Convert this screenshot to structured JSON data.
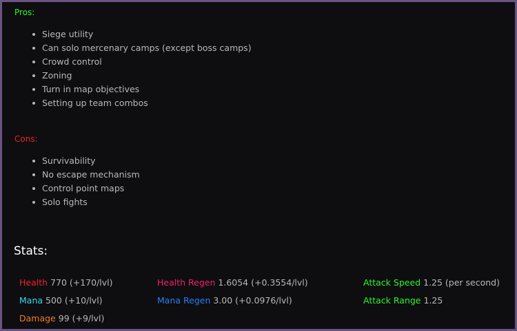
{
  "pros": {
    "heading": "Pros:",
    "items": [
      "Siege utility",
      "Can solo mercenary camps (except boss camps)",
      "Crowd control",
      "Zoning",
      "Turn in map objectives",
      "Setting up team combos"
    ]
  },
  "cons": {
    "heading": "Cons:",
    "items": [
      "Survivability",
      "No escape mechanism",
      "Control point maps",
      "Solo fights"
    ]
  },
  "stats": {
    "title": "Stats:",
    "health": {
      "label": "Health",
      "value": "770 (+170/lvl)",
      "color": "#f0202a"
    },
    "mana": {
      "label": "Mana",
      "value": "500 (+10/lvl)",
      "color": "#3fd9f0"
    },
    "damage": {
      "label": "Damage",
      "value": "99 (+9/lvl)",
      "color": "#f07a2a"
    },
    "health_regen": {
      "label": "Health Regen",
      "value": "1.6054 (+0.3554/lvl)",
      "color": "#f0206a"
    },
    "mana_regen": {
      "label": "Mana Regen",
      "value": "3.00 (+0.0976/lvl)",
      "color": "#2a7df0"
    },
    "attack_speed": {
      "label": "Attack Speed",
      "value": "1.25 (per second)",
      "color": "#2df52d"
    },
    "attack_range": {
      "label": "Attack Range",
      "value": "1.25",
      "color": "#2df52d"
    }
  }
}
